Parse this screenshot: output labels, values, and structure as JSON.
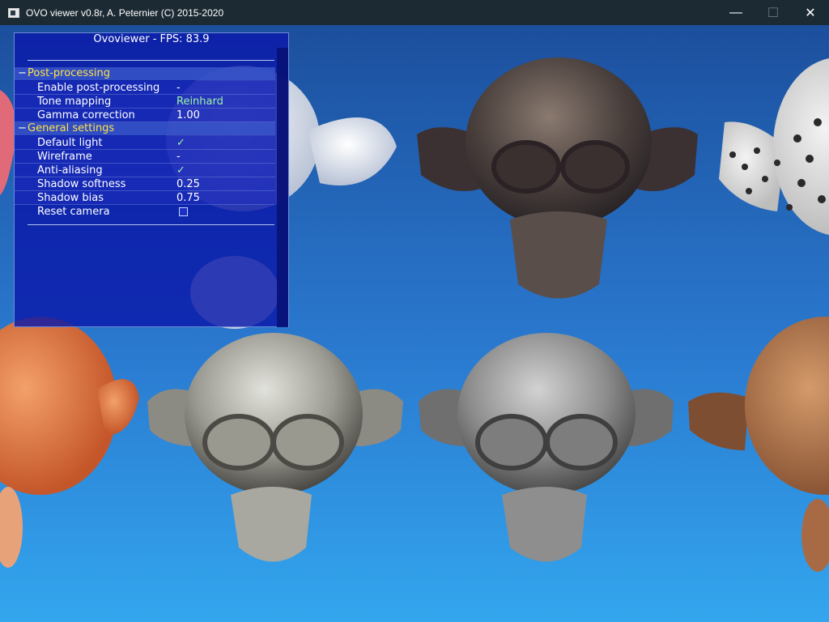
{
  "window": {
    "title": "OVO viewer v0.8r, A. Peternier (C) 2015-2020",
    "minimize_glyph": "—",
    "maximize_glyph": "☐",
    "close_glyph": "✕"
  },
  "panel": {
    "title": "Ovoviewer - FPS: 83.9",
    "sections": [
      {
        "toggle": "−",
        "label": "Post-processing",
        "items": [
          {
            "label": "Enable post-processing",
            "value": "-"
          },
          {
            "label": "Tone mapping",
            "value": "Reinhard"
          },
          {
            "label": "Gamma correction",
            "value": "1.00"
          }
        ]
      },
      {
        "toggle": "−",
        "label": "General settings",
        "items": [
          {
            "label": "Default light",
            "value": "✓"
          },
          {
            "label": "Wireframe",
            "value": "-"
          },
          {
            "label": "Anti-aliasing",
            "value": "✓"
          },
          {
            "label": "Shadow softness",
            "value": "0.25"
          },
          {
            "label": "Shadow bias",
            "value": "0.75"
          },
          {
            "label": "Reset camera",
            "value": ""
          }
        ]
      }
    ]
  },
  "colors": {
    "titlebar": "#1c2a33",
    "panel_bg": "#0a19aa",
    "section_label": "#ffe24a",
    "value_green": "#9cf1a8",
    "sky_top": "#1c4f9d",
    "sky_bottom": "#33a6ee"
  },
  "scene": {
    "monkeys": [
      "white",
      "dark-stone",
      "leopard",
      "orange-rust",
      "granite",
      "grey-marble",
      "wood"
    ]
  }
}
